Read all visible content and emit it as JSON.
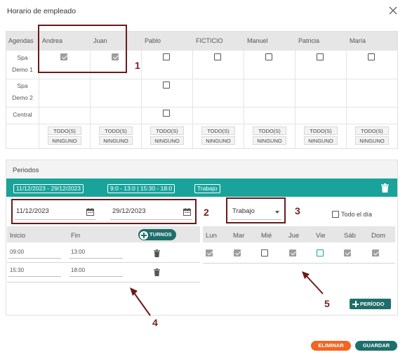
{
  "dialog": {
    "title": "Horario de empleado"
  },
  "agendas": {
    "header": "Agendas",
    "employees": [
      "Andrea",
      "Juan",
      "Pablo",
      "FICTICIO",
      "Manuel",
      "Patricia",
      "María"
    ],
    "rows": [
      {
        "label_line1": "Spa",
        "label_line2": "Demo 1",
        "checks": [
          true,
          true,
          false,
          false,
          false,
          false,
          false
        ]
      },
      {
        "label_line1": "Spa",
        "label_line2": "Demo 2",
        "checks": [
          null,
          null,
          false,
          null,
          null,
          null,
          null
        ]
      },
      {
        "label_line1": "Central",
        "label_line2": "",
        "checks": [
          null,
          null,
          false,
          null,
          null,
          null,
          null
        ]
      }
    ],
    "all_label": "TODO(S)",
    "none_label": "NINGUNO"
  },
  "periods": {
    "title": "Periodos",
    "summary": {
      "range": "11/12/2023 - 29/12/2023",
      "hours": "9:0 - 13:0 | 15:30 - 18:0",
      "type": "Trabajo"
    },
    "start_date": "11/12/2023",
    "end_date": "29/12/2023",
    "type_selected": "Trabajo",
    "all_day_label": "Todo el día",
    "shifts": {
      "col_start": "Inicio",
      "col_end": "Fin",
      "add_label": "TURNOS",
      "rows": [
        {
          "start": "09:00",
          "end": "13:00"
        },
        {
          "start": "15:30",
          "end": "18:00"
        }
      ]
    },
    "days": {
      "labels": [
        "Lun",
        "Mar",
        "Mié",
        "Jue",
        "Vie",
        "Sáb",
        "Dom"
      ],
      "checked": [
        true,
        true,
        false,
        true,
        false,
        true,
        true
      ]
    },
    "add_period_label": "PERÍODO"
  },
  "annotations": {
    "n1": "1",
    "n2": "2",
    "n3": "3",
    "n4": "4",
    "n5": "5"
  },
  "actions": {
    "delete_label": "ELIMINAR",
    "save_label": "GUARDAR"
  },
  "colors": {
    "teal": "#1aa39a",
    "dark_teal": "#1e6f6a",
    "orange": "#f26522",
    "annotation": "#6b1a1a"
  }
}
